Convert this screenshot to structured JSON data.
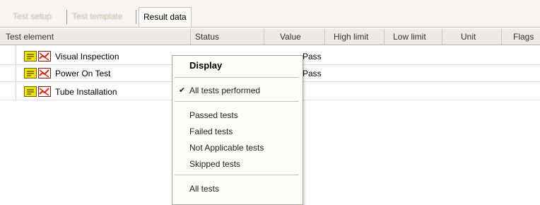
{
  "tabs": [
    {
      "label": "Test setup"
    },
    {
      "label": "Test template"
    },
    {
      "label": "Result data"
    }
  ],
  "columns": [
    {
      "label": "Test element"
    },
    {
      "label": "Status"
    },
    {
      "label": "Value"
    },
    {
      "label": "High limit"
    },
    {
      "label": "Low limit"
    },
    {
      "label": "Unit"
    },
    {
      "label": "Flags"
    }
  ],
  "rows": [
    {
      "name": "Visual Inspection",
      "value": "Pass"
    },
    {
      "name": "Power On Test",
      "value": "Pass"
    },
    {
      "name": "Tube Installation",
      "value": ""
    }
  ],
  "context_menu": {
    "title": "Display",
    "items": [
      {
        "label": "All tests performed",
        "checked": true
      },
      {
        "label": "Passed tests"
      },
      {
        "label": "Failed tests"
      },
      {
        "label": "Not Applicable tests"
      },
      {
        "label": "Skipped tests"
      },
      {
        "label": "All tests"
      }
    ]
  },
  "colors": {
    "icon_yellow": "#f2e20a",
    "icon_red": "#d9281e",
    "header_bg": "#ebeae3"
  }
}
